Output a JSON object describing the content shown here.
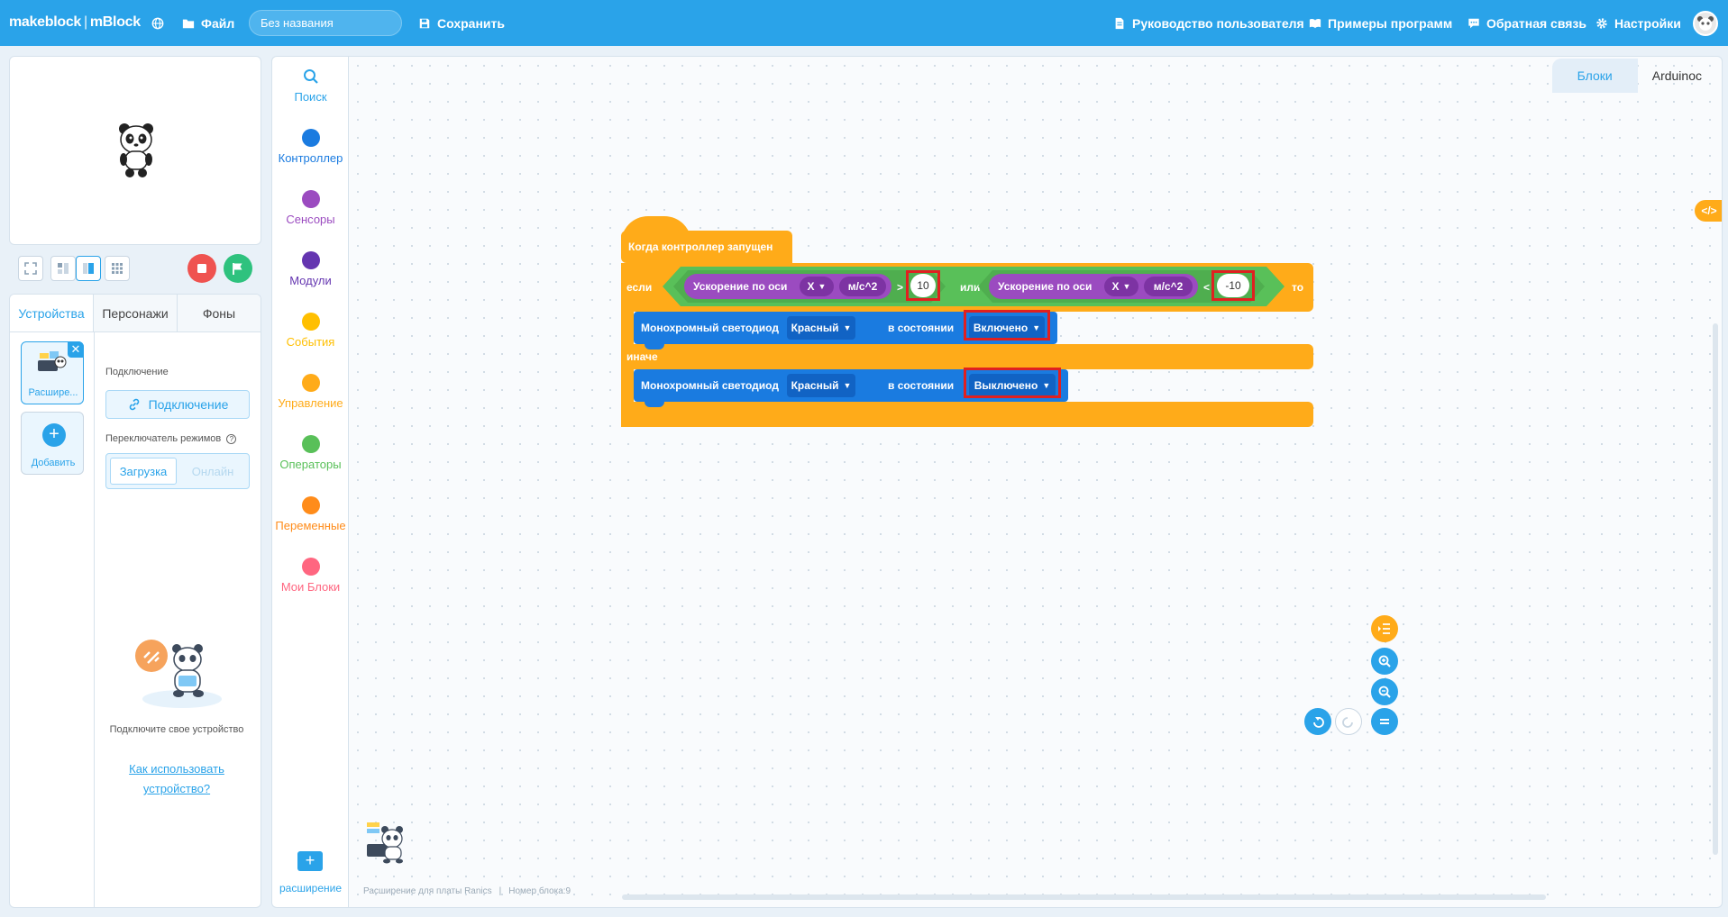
{
  "topbar": {
    "logo_brand": "makeblock",
    "logo_product": "mBlock",
    "file_label": "Файл",
    "project_name": "Без названия",
    "save_label": "Сохранить",
    "guide_label": "Руководство пользователя",
    "examples_label": "Примеры программ",
    "feedback_label": "Обратная связь",
    "settings_label": "Настройки"
  },
  "left_panel": {
    "tabs": [
      {
        "label": "Устройства",
        "active": true
      },
      {
        "label": "Персонажи",
        "active": false
      },
      {
        "label": "Фоны",
        "active": false
      }
    ],
    "device_label": "Расширение для платы Ranics",
    "device_label_short": "Расшире...",
    "add_label": "Добавить",
    "connection_section": "Подключение",
    "connect_button": "Подключение",
    "mode_section": "Переключатель режимов",
    "mode_upload": "Загрузка",
    "mode_live": "Онлайн",
    "hint_text": "Подключите свое устройство",
    "hint_link": "Как использовать устройство?"
  },
  "categories": [
    {
      "label": "Поиск",
      "color": "#2aa3e9"
    },
    {
      "label": "Контроллер",
      "color": "#1a7be0"
    },
    {
      "label": "Сенсоры",
      "color": "#9b4bc0"
    },
    {
      "label": "Модули",
      "color": "#6435b0"
    },
    {
      "label": "События",
      "color": "#ffbf00"
    },
    {
      "label": "Управление",
      "color": "#ffab19"
    },
    {
      "label": "Операторы",
      "color": "#59c059"
    },
    {
      "label": "Переменные",
      "color": "#ff8c1a"
    },
    {
      "label": "Мои Блоки",
      "color": "#ff6680"
    }
  ],
  "extension_label": "расширение",
  "workspace": {
    "tabs": [
      {
        "label": "Блоки",
        "active": true
      },
      {
        "label": "Arduinoc",
        "active": false
      }
    ],
    "status_extension": "Расширение для платы Ranics",
    "status_block_no": "Номер блока:9"
  },
  "blocks": {
    "hat_label": "Когда контроллер запущен",
    "if_kw": "если",
    "then_kw": "то",
    "else_kw": "иначе",
    "or_kw": "или",
    "accel_label": "Ускорение по оси",
    "axis_value": "X",
    "unit_label": "м/с^2",
    "gt_op": ">",
    "lt_op": "<",
    "threshold_high": "10",
    "threshold_low": "-10",
    "led_label": "Монохромный светодиод",
    "color_value": "Красный",
    "state_label": "в состоянии",
    "state_on": "Включено",
    "state_off": "Выключено"
  },
  "colors": {
    "accent": "#2aa3e9",
    "control": "#ffab19",
    "operators": "#59c059",
    "sensors": "#9b4bc0",
    "controller": "#1a7be0",
    "highlight": "#e02020"
  }
}
